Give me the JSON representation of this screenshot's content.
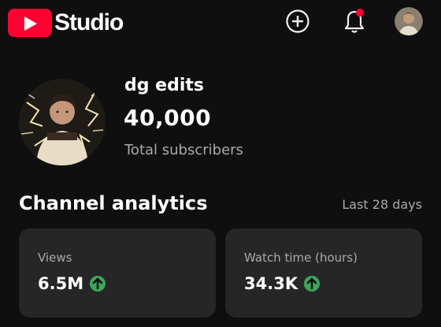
{
  "app": {
    "logo_text": "Studio"
  },
  "header": {
    "icons": [
      "create-icon",
      "notifications-bell-icon",
      "account-avatar"
    ],
    "notification_dot_color": "#ff0033"
  },
  "channel": {
    "name": "dg edits",
    "subscribers": "40,000",
    "subscribers_label": "Total subscribers"
  },
  "analytics": {
    "title": "Channel analytics",
    "period": "Last 28 days",
    "cards": [
      {
        "label": "Views",
        "value": "6.5M",
        "trend": "up"
      },
      {
        "label": "Watch time (hours)",
        "value": "34.3K",
        "trend": "up"
      }
    ],
    "trend_up_color": "#3ea55c"
  },
  "colors": {
    "background": "#0f0f0f",
    "card": "#262626",
    "brand": "#ff0033"
  }
}
